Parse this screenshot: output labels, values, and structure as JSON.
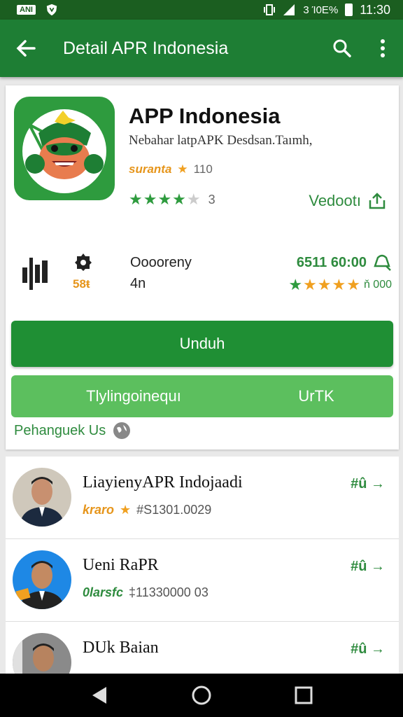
{
  "status_bar": {
    "badge": "ΑΝΙ",
    "signal_text": "3 Ί0Ε%",
    "time": "11:30"
  },
  "app_bar": {
    "title": "Detail APR Indonesia"
  },
  "app": {
    "name": "APP Indonesia",
    "subtitle": "Nebahar latpAPK Desdsan.Taımh,",
    "tag": "suranta",
    "tag_count": "110",
    "rating_count": "3",
    "stars_filled": 4,
    "share_label": "Vedootı"
  },
  "stats": {
    "num": "58ŧ",
    "category_label": "Ooooreny",
    "category_value": "4n",
    "right_value": "6511 60:00",
    "rating_label": "ň 000"
  },
  "buttons": {
    "primary": "Unduh",
    "secondary_left": "Tlylingoinequı",
    "secondary_right": "UrTK"
  },
  "contact": {
    "label": "Pehanguek Us"
  },
  "list": [
    {
      "title": "LiayienyAPR Indojaadi",
      "sub_tag": "kraro",
      "sub_num": "#S1301.0029",
      "action": "#û →"
    },
    {
      "title": "Ueni RaPR",
      "sub_tag": "0larsfc",
      "sub_num": "‡11330000 03",
      "action": "#û →"
    },
    {
      "title": "DUk Baian",
      "sub_tag": "",
      "sub_num": "",
      "action": "#û →"
    }
  ],
  "colors": {
    "primary": "#1f8f34",
    "appbar": "#1e7e34",
    "statusbar": "#1b5e20",
    "secondary": "#5cbf5e",
    "accent_orange": "#e6951b"
  }
}
